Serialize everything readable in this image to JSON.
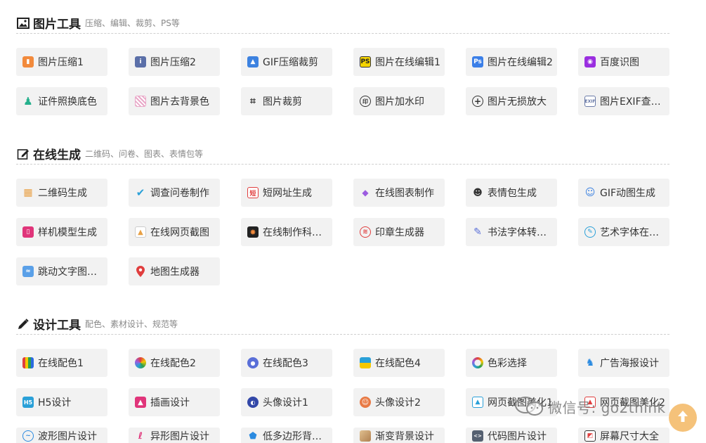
{
  "sections": [
    {
      "title": "图片工具",
      "subtitle": "压缩、编辑、裁剪、PS等",
      "icon": "image-icon",
      "items": [
        {
          "label": "图片压缩1",
          "icon": "file-orange-icon",
          "color": "#f28a3c"
        },
        {
          "label": "图片压缩2",
          "icon": "file-blue-icon",
          "color": "#5b6fa8"
        },
        {
          "label": "GIF压缩裁剪",
          "icon": "gif-logo-icon",
          "color": "#3d82e0"
        },
        {
          "label": "图片在线编辑1",
          "icon": "ps-yellow-icon",
          "color": "#f5d400"
        },
        {
          "label": "图片在线编辑2",
          "icon": "ps-blue-icon",
          "color": "#3b7fe8"
        },
        {
          "label": "百度识图",
          "icon": "camera-purple-icon",
          "color": "#9a2ee0"
        },
        {
          "label": "证件照换底色",
          "icon": "person-green-icon",
          "color": "#25b08c"
        },
        {
          "label": "图片去背景色",
          "icon": "stripes-icon",
          "color": "#e9a8c8"
        },
        {
          "label": "图片裁剪",
          "icon": "crop-icon",
          "color": "#333333"
        },
        {
          "label": "图片加水印",
          "icon": "stamp-circle-icon",
          "color": "#333333"
        },
        {
          "label": "图片无损放大",
          "icon": "zoom-in-icon",
          "color": "#333333"
        },
        {
          "label": "图片EXIF查…",
          "icon": "exif-icon",
          "color": "#6b7ba8"
        }
      ]
    },
    {
      "title": "在线生成",
      "subtitle": "二维码、问卷、图表、表情包等",
      "icon": "edit-icon",
      "items": [
        {
          "label": "二维码生成",
          "icon": "qrcode-icon",
          "color": "#e8a045"
        },
        {
          "label": "调查问卷制作",
          "icon": "check-icon",
          "color": "#2aa0d8"
        },
        {
          "label": "短网址生成",
          "icon": "short-url-icon",
          "color": "#e03e3e"
        },
        {
          "label": "在线图表制作",
          "icon": "cube-icon",
          "color": "#9c5ce0"
        },
        {
          "label": "表情包生成",
          "icon": "panda-icon",
          "color": "#333333"
        },
        {
          "label": "GIF动图生成",
          "icon": "face-icon",
          "color": "#3d82e0"
        },
        {
          "label": "样机模型生成",
          "icon": "phone-icon",
          "color": "#e0357a"
        },
        {
          "label": "在线网页截图",
          "icon": "screenshot-icon",
          "color": "#e8a045"
        },
        {
          "label": "在线制作科…",
          "icon": "science-icon",
          "color": "#f28a3c"
        },
        {
          "label": "印章生成器",
          "icon": "seal-icon",
          "color": "#e03e3e"
        },
        {
          "label": "书法字体转…",
          "icon": "brush-icon",
          "color": "#5a6fd8"
        },
        {
          "label": "艺术字体在…",
          "icon": "art-font-icon",
          "color": "#2aa0d8"
        },
        {
          "label": "跳动文字图…",
          "icon": "doc-blue-icon",
          "color": "#5aa0e8"
        },
        {
          "label": "地图生成器",
          "icon": "map-pin-icon",
          "color": "#e03e3e"
        }
      ]
    },
    {
      "title": "设计工具",
      "subtitle": "配色、素材设计、规范等",
      "icon": "pencil-icon",
      "items": [
        {
          "label": "在线配色1",
          "icon": "palette-bars-icon",
          "color": "#e03e3e"
        },
        {
          "label": "在线配色2",
          "icon": "color-wheel-icon",
          "color": "#f2a03c"
        },
        {
          "label": "在线配色3",
          "icon": "paint-palette-icon",
          "color": "#5a6fd8"
        },
        {
          "label": "在线配色4",
          "icon": "color-squares-icon",
          "color": "#2aa0d8"
        },
        {
          "label": "色彩选择",
          "icon": "color-ring-icon",
          "color": "#9c5ce0"
        },
        {
          "label": "广告海报设计",
          "icon": "poster-icon",
          "color": "#2a8ae0"
        },
        {
          "label": "H5设计",
          "icon": "h5-icon",
          "color": "#2aa0d8"
        },
        {
          "label": "插画设计",
          "icon": "illustration-icon",
          "color": "#e0357a"
        },
        {
          "label": "头像设计1",
          "icon": "avatar-ring-icon",
          "color": "#3348a8"
        },
        {
          "label": "头像设计2",
          "icon": "avatar-face-icon",
          "color": "#e87a45"
        },
        {
          "label": "网页截图美化1",
          "icon": "image-frame-icon",
          "color": "#2aa0d8"
        },
        {
          "label": "网页截图美化2",
          "icon": "image-red-icon",
          "color": "#e03e3e"
        },
        {
          "label": "波形图片设计",
          "icon": "wave-icon",
          "color": "#2a8ae0"
        },
        {
          "label": "异形图片设计",
          "icon": "curve-icon",
          "color": "#e0357a"
        },
        {
          "label": "低多边形背…",
          "icon": "polygon-icon",
          "color": "#2a8ae0"
        },
        {
          "label": "渐变背景设计",
          "icon": "gradient-icon",
          "color": "#c8a070"
        },
        {
          "label": "代码图片设计",
          "icon": "code-icon",
          "color": "#556070"
        },
        {
          "label": "屏幕尺寸大全",
          "icon": "screen-size-icon",
          "color": "#e03e3e"
        }
      ]
    }
  ],
  "watermark": {
    "text": "微信号: go2think",
    "icon": "wechat-icon"
  },
  "fab": {
    "icon": "arrow-up-icon",
    "color": "#f5c27a"
  }
}
